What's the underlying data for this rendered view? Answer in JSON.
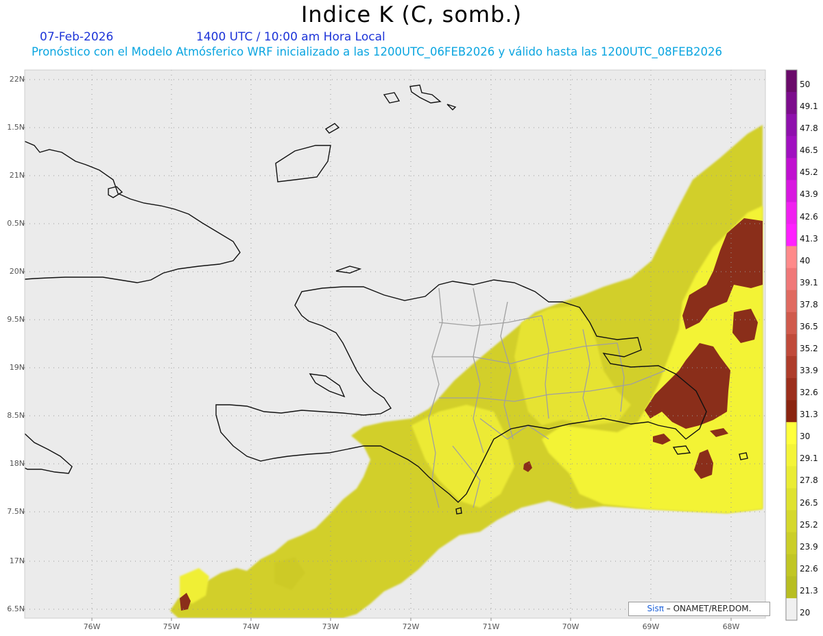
{
  "header": {
    "title": "Indice K (C, somb.)",
    "date": "07-Feb-2026",
    "time": "1400 UTC / 10:00 am Hora Local",
    "description": "Pronóstico con el Modelo Atmósferico WRF inicializado a las 1200UTC_06FEB2026 y válido hasta las  1200UTC_08FEB2026"
  },
  "axes": {
    "lat_labels": [
      "22N",
      "1.5N",
      "21N",
      "0.5N",
      "20N",
      "9.5N",
      "19N",
      "8.5N",
      "18N",
      "7.5N",
      "17N",
      "6.5N"
    ],
    "lat_values": [
      22,
      21.5,
      21,
      20.5,
      20,
      19.5,
      19,
      18.5,
      18,
      17.5,
      17,
      16.5
    ],
    "lon_labels": [
      "76W",
      "75W",
      "74W",
      "73W",
      "72W",
      "71W",
      "70W",
      "69W",
      "68W"
    ],
    "lon_values": [
      -76,
      -75,
      -74,
      -73,
      -72,
      -71,
      -70,
      -69,
      -68
    ]
  },
  "colorbar": {
    "labels": [
      "50",
      "49.1",
      "47.8",
      "46.5",
      "45.2",
      "43.9",
      "42.6",
      "41.3",
      "40",
      "39.1",
      "37.8",
      "36.5",
      "35.2",
      "33.9",
      "32.6",
      "31.3",
      "30",
      "29.1",
      "27.8",
      "26.5",
      "25.2",
      "23.9",
      "22.6",
      "21.3",
      "20"
    ],
    "colors": [
      "#6a0a6a",
      "#7c0c8c",
      "#8e10ac",
      "#a010c0",
      "#c010d0",
      "#d818e0",
      "#f020f0",
      "#ff20ff",
      "#ff8a8a",
      "#f07878",
      "#e06a60",
      "#d05a4c",
      "#c04a3a",
      "#ae3c2a",
      "#9c2e1c",
      "#8a2410",
      "#ffff3c",
      "#f4f438",
      "#eaec34",
      "#dfe230",
      "#d5d82c",
      "#cbce28",
      "#c1c624",
      "#b8be22",
      "#f0f0f0"
    ]
  },
  "colors": {
    "background": "#ebebeb",
    "yellow_low": "#c8c626",
    "yellow_high": "#f4f436",
    "brown": "#8a2e1a",
    "coast": "#111111",
    "provinces": "#a0a0a0"
  },
  "credit": {
    "logo": "Sisπ",
    "text": "– ONAMET/REP.DOM."
  }
}
